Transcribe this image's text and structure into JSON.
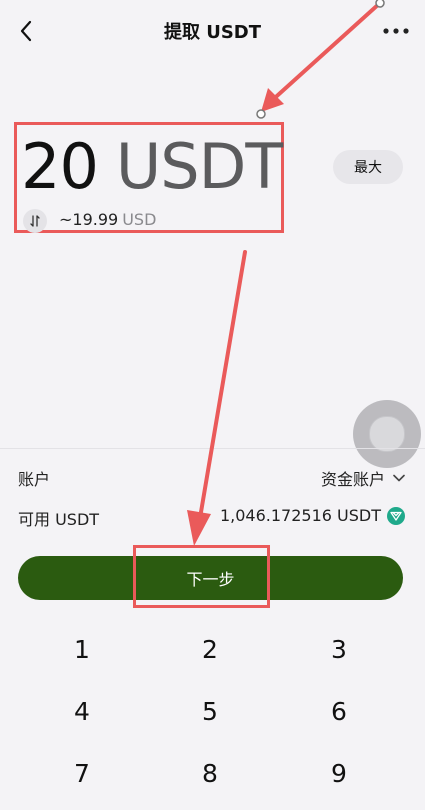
{
  "header": {
    "title": "提取 USDT",
    "back_icon": "back-arrow-icon",
    "more_icon": "more-dots-icon"
  },
  "amount": {
    "value": "20",
    "unit": "USDT",
    "usd_value": "~19.99",
    "usd_unit": "USD",
    "swap_icon": "swap-arrows-icon"
  },
  "max_button": {
    "label": "最大"
  },
  "account": {
    "label": "账户",
    "value": "资金账户"
  },
  "available": {
    "label": "可用 USDT",
    "value": "1,046.172516 USDT",
    "icon": "tron-icon"
  },
  "next_button": {
    "label": "下一步"
  },
  "keypad": {
    "keys": [
      "1",
      "2",
      "3",
      "4",
      "5",
      "6",
      "7",
      "8",
      "9"
    ]
  },
  "colors": {
    "primary_button": "#2b5b10",
    "annotation": "#ea5a5a",
    "background": "#f4f3f6",
    "tron": "#1fa98b"
  }
}
